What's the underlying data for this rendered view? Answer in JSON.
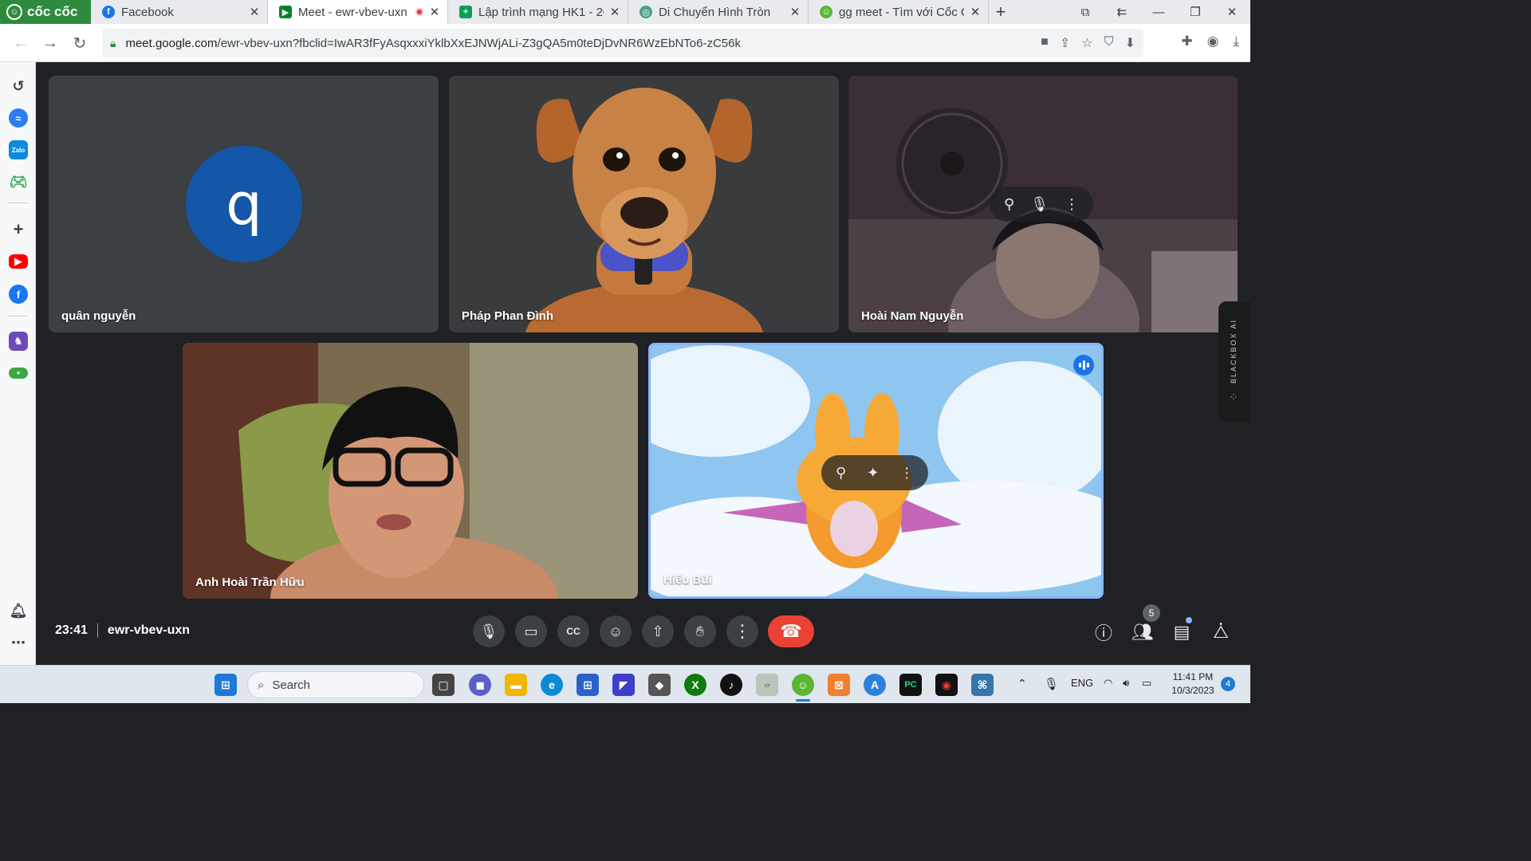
{
  "browser": {
    "brand": "cốc cốc",
    "tabs": [
      {
        "title": "Facebook",
        "active": false
      },
      {
        "title": "Meet - ewr-vbev-uxn",
        "active": true
      },
      {
        "title": "Lập trình mạng HK1 - 202",
        "active": false
      },
      {
        "title": "Di Chuyển Hình Tròn",
        "active": false
      },
      {
        "title": "gg meet - Tìm với Cốc Cố",
        "active": false
      }
    ],
    "url_domain": "meet.google.com",
    "url_path": "/ewr-vbev-uxn?fbclid=IwAR3fFyAsqxxxiYklbXxEJNWjALi-Z3gQA5m0teDjDvNR6WzEbNTo6-zC56k"
  },
  "meet": {
    "participants": [
      {
        "name": "quân nguyễn",
        "avatar_letter": "q"
      },
      {
        "name": "Pháp Phan Đình"
      },
      {
        "name": "Hoài Nam Nguyễn"
      },
      {
        "name": "Anh Hoài Trần Hữu"
      },
      {
        "name": "Hiếu Bùi"
      }
    ],
    "time": "23:41",
    "meeting_code": "ewr-vbev-uxn",
    "people_count": "5",
    "blackbox_label": "BLACKBOX AI"
  },
  "taskbar": {
    "search_placeholder": "Search",
    "language": "ENG",
    "time": "11:41 PM",
    "date": "10/3/2023",
    "notification_count": "4"
  },
  "colors": {
    "meet_bg": "#202124",
    "end_call": "#ea4335",
    "avatar_blue": "#1457a8",
    "speaking_blue": "#1a73e8",
    "brand_green": "#2e8b3e"
  }
}
